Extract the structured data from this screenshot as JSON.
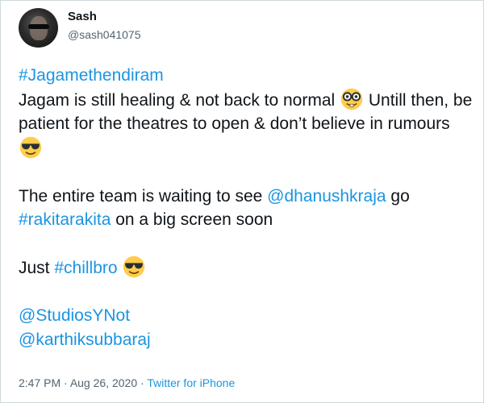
{
  "author": {
    "display_name": "Sash",
    "handle": "@sash041075"
  },
  "tweet": {
    "hashtag_title": "#Jagamethendiram",
    "line1_text": "Jagam is still healing & not back to normal ",
    "line1_tail": " Untill then, be patient for the theatres to open & don’t believe in rumours ",
    "p2_text_a": "The entire team is waiting to see ",
    "p2_mention": "@dhanushkraja",
    "p2_text_b": " go ",
    "p2_hashtag": "#rakitarakita",
    "p2_text_c": " on a big screen soon",
    "p3_text": "Just ",
    "p3_hashtag": "#chillbro",
    "mention_1": "@StudiosYNot",
    "mention_2": "@karthiksubbaraj",
    "emojis": [
      "nerd-face-emoji",
      "sunglasses-emoji",
      "sunglasses-emoji"
    ]
  },
  "meta": {
    "time": "2:47 PM",
    "separator_1": " · ",
    "date": "Aug 26, 2020",
    "separator_2": " · ",
    "source": "Twitter for iPhone"
  },
  "colors": {
    "link": "#1b95e0",
    "text": "#0f1419",
    "secondary": "#536471",
    "border": "#cfd9de",
    "emoji_yellow": "#ffcc4d"
  }
}
